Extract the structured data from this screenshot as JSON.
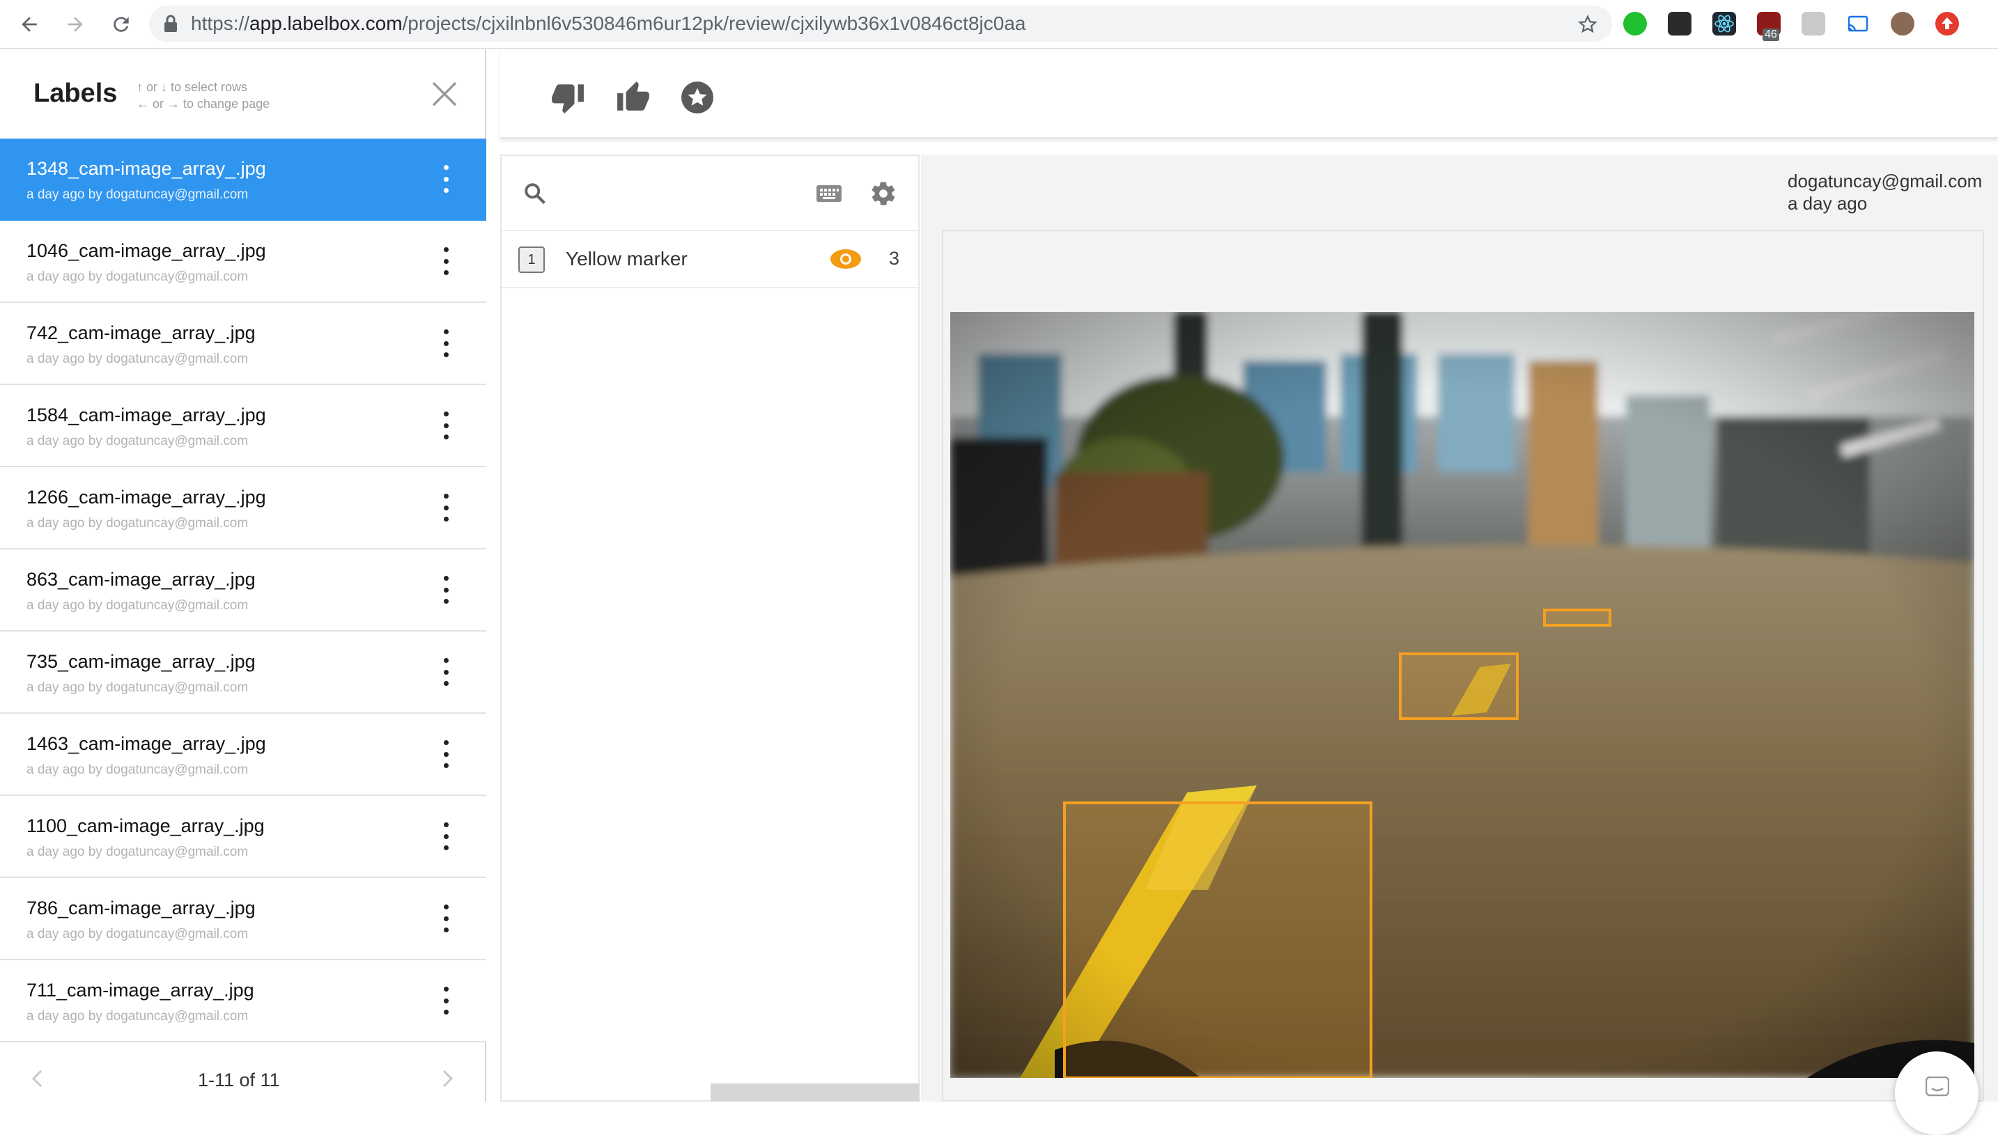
{
  "browser": {
    "url_scheme": "https://",
    "url_host": "app.labelbox.com",
    "url_path": "/projects/cjxilnbnl6v530846m6ur12pk/review/cjxilywb36x1v0846ct8jc0aa",
    "extension_badge": "46",
    "icons": [
      "back-arrow-icon",
      "forward-arrow-icon",
      "reload-icon",
      "lock-icon",
      "bookmark-star-icon"
    ]
  },
  "labels_panel": {
    "title": "Labels",
    "hint_line1": "↑ or ↓ to select rows",
    "hint_line2": "← or → to change page",
    "items": [
      {
        "filename": "1348_cam-image_array_.jpg",
        "meta": "a day ago by dogatuncay@gmail.com"
      },
      {
        "filename": "1046_cam-image_array_.jpg",
        "meta": "a day ago by dogatuncay@gmail.com"
      },
      {
        "filename": "742_cam-image_array_.jpg",
        "meta": "a day ago by dogatuncay@gmail.com"
      },
      {
        "filename": "1584_cam-image_array_.jpg",
        "meta": "a day ago by dogatuncay@gmail.com"
      },
      {
        "filename": "1266_cam-image_array_.jpg",
        "meta": "a day ago by dogatuncay@gmail.com"
      },
      {
        "filename": "863_cam-image_array_.jpg",
        "meta": "a day ago by dogatuncay@gmail.com"
      },
      {
        "filename": "735_cam-image_array_.jpg",
        "meta": "a day ago by dogatuncay@gmail.com"
      },
      {
        "filename": "1463_cam-image_array_.jpg",
        "meta": "a day ago by dogatuncay@gmail.com"
      },
      {
        "filename": "1100_cam-image_array_.jpg",
        "meta": "a day ago by dogatuncay@gmail.com"
      },
      {
        "filename": "786_cam-image_array_.jpg",
        "meta": "a day ago by dogatuncay@gmail.com"
      },
      {
        "filename": "711_cam-image_array_.jpg",
        "meta": "a day ago by dogatuncay@gmail.com"
      }
    ],
    "selected_index": 0,
    "pagination": "1-11 of 11"
  },
  "review_toolbar": {
    "icons": [
      "thumbs-down-icon",
      "thumbs-up-icon",
      "star-icon"
    ]
  },
  "tools_panel": {
    "icons": [
      "search-icon",
      "keyboard-icon",
      "settings-gear-icon"
    ],
    "tools": [
      {
        "hotkey": "1",
        "name": "Yellow marker",
        "count": "3",
        "visible": true
      }
    ]
  },
  "viewer": {
    "reviewer_email": "dogatuncay@gmail.com",
    "reviewed_at": "a day ago",
    "box_color": "#f5a020"
  },
  "colors": {
    "selected_row": "#2f95ee",
    "tool_accent": "#f39c12"
  }
}
